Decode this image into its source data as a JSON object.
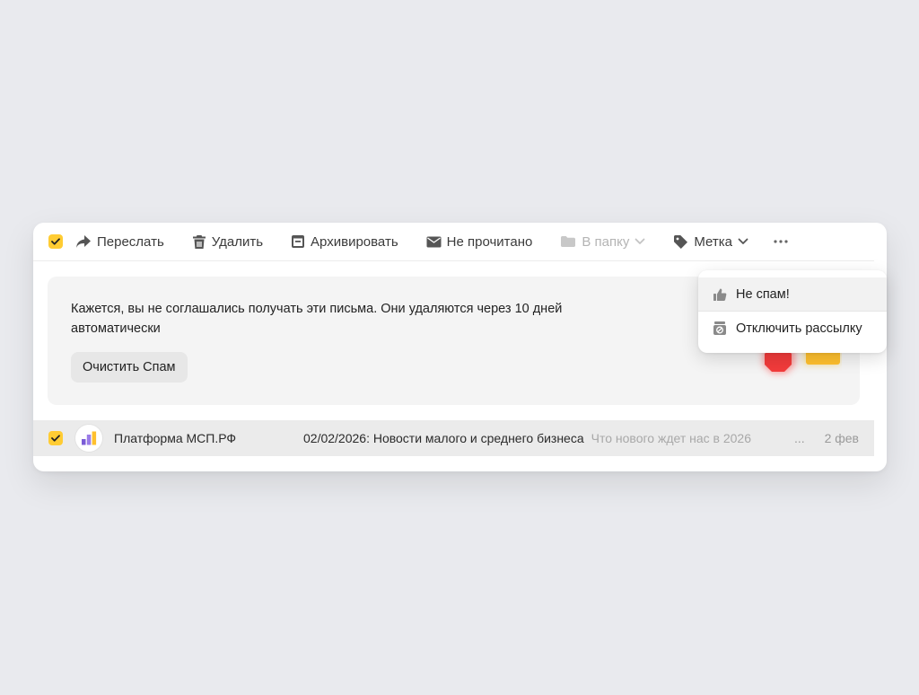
{
  "toolbar": {
    "forward_label": "Переслать",
    "delete_label": "Удалить",
    "archive_label": "Архивировать",
    "unread_label": "Не прочитано",
    "folder_label": "В папку",
    "tag_label": "Метка",
    "more_icon": "more-dots-icon"
  },
  "banner": {
    "text": "Кажется, вы не соглашались получать эти письма. Они удаляются через 10 дней автоматически",
    "clear_button": "Очистить Спам"
  },
  "messages": [
    {
      "sender": "Платформа МСП.РФ",
      "subject": "02/02/2026: Новости малого и среднего бизнеса",
      "snippet": "Что нового ждет нас в 2026",
      "ellipsis": "...",
      "date": "2 фев"
    }
  ],
  "dropdown": {
    "items": [
      {
        "label": "Не спам!",
        "icon": "thumbs-up-icon"
      },
      {
        "label": "Отключить рассылку",
        "icon": "unsubscribe-icon"
      }
    ]
  },
  "colors": {
    "accent": "#ffcc33",
    "background": "#e9eaee",
    "row_selected": "#ebebeb"
  }
}
